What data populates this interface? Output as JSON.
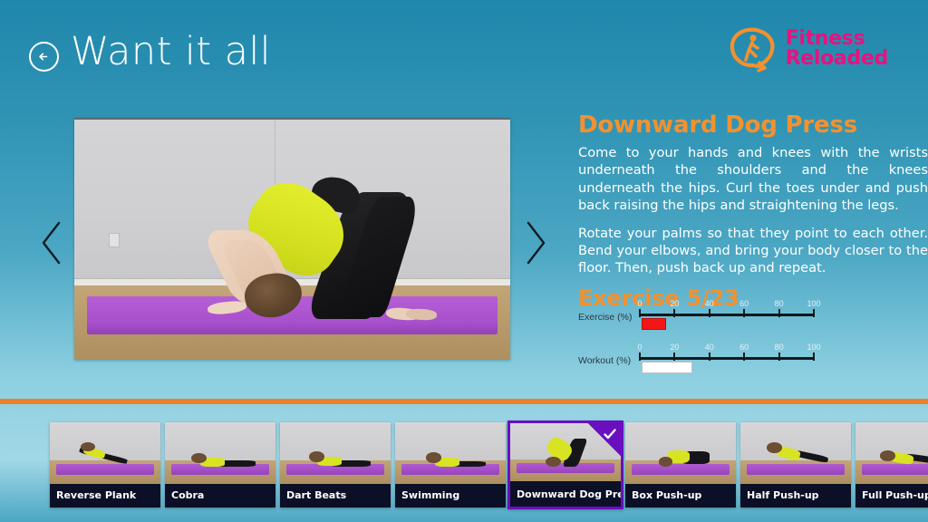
{
  "header": {
    "back_icon": "back-arrow-icon",
    "title": "Want it all",
    "brand": {
      "icon": "fitness-runner-swoosh-icon",
      "line1": "Fitness",
      "line2": "Reloaded",
      "color": "#e8127f",
      "icon_color": "#f3912f"
    }
  },
  "media": {
    "prev_icon": "chevron-left-icon",
    "next_icon": "chevron-right-icon",
    "alt": "Woman performing downward dog press on a purple yoga mat"
  },
  "exercise": {
    "title": "Downward Dog Press",
    "title_color": "#f3912f",
    "paragraph1": "Come to your hands and knees with the wrists underneath the shoulders and the knees underneath the hips. Curl the toes under and push back raising the hips and straightening the legs.",
    "paragraph2": "Rotate your palms so that they point to each other. Bend your elbows, and bring your body closer to the floor. Then, push back up and repeat.",
    "counter": "Exercise 5/23",
    "current_index": 5,
    "total": 23
  },
  "sliders": [
    {
      "label": "Exercise (%)",
      "ticks": [
        "0",
        "20",
        "40",
        "60",
        "80",
        "100"
      ],
      "min": 0,
      "max": 100,
      "value": 5,
      "thumb_color": "#f41616",
      "thumb_width_pct": 14,
      "thumb_start_pct": 1
    },
    {
      "label": "Workout (%)",
      "ticks": [
        "0",
        "20",
        "40",
        "60",
        "80",
        "100"
      ],
      "min": 0,
      "max": 100,
      "value": 18,
      "thumb_color": "#ffffff",
      "thumb_width_pct": 29,
      "thumb_start_pct": 1
    }
  ],
  "divider_color": "#f08027",
  "filmstrip": {
    "items": [
      {
        "label": "Reverse Plank",
        "selected": false,
        "pose": "reverse-plank"
      },
      {
        "label": "Cobra",
        "selected": false,
        "pose": "cobra"
      },
      {
        "label": "Dart Beats",
        "selected": false,
        "pose": "dart-beats"
      },
      {
        "label": "Swimming",
        "selected": false,
        "pose": "swimming"
      },
      {
        "label": "Downward Dog Press",
        "selected": true,
        "pose": "downward-dog"
      },
      {
        "label": "Box Push-up",
        "selected": false,
        "pose": "box-pushup"
      },
      {
        "label": "Half Push-up",
        "selected": false,
        "pose": "half-pushup"
      },
      {
        "label": "Full Push-up",
        "selected": false,
        "pose": "full-pushup"
      }
    ],
    "selected_check_icon": "check-icon",
    "selection_color": "#6a0fc0"
  }
}
